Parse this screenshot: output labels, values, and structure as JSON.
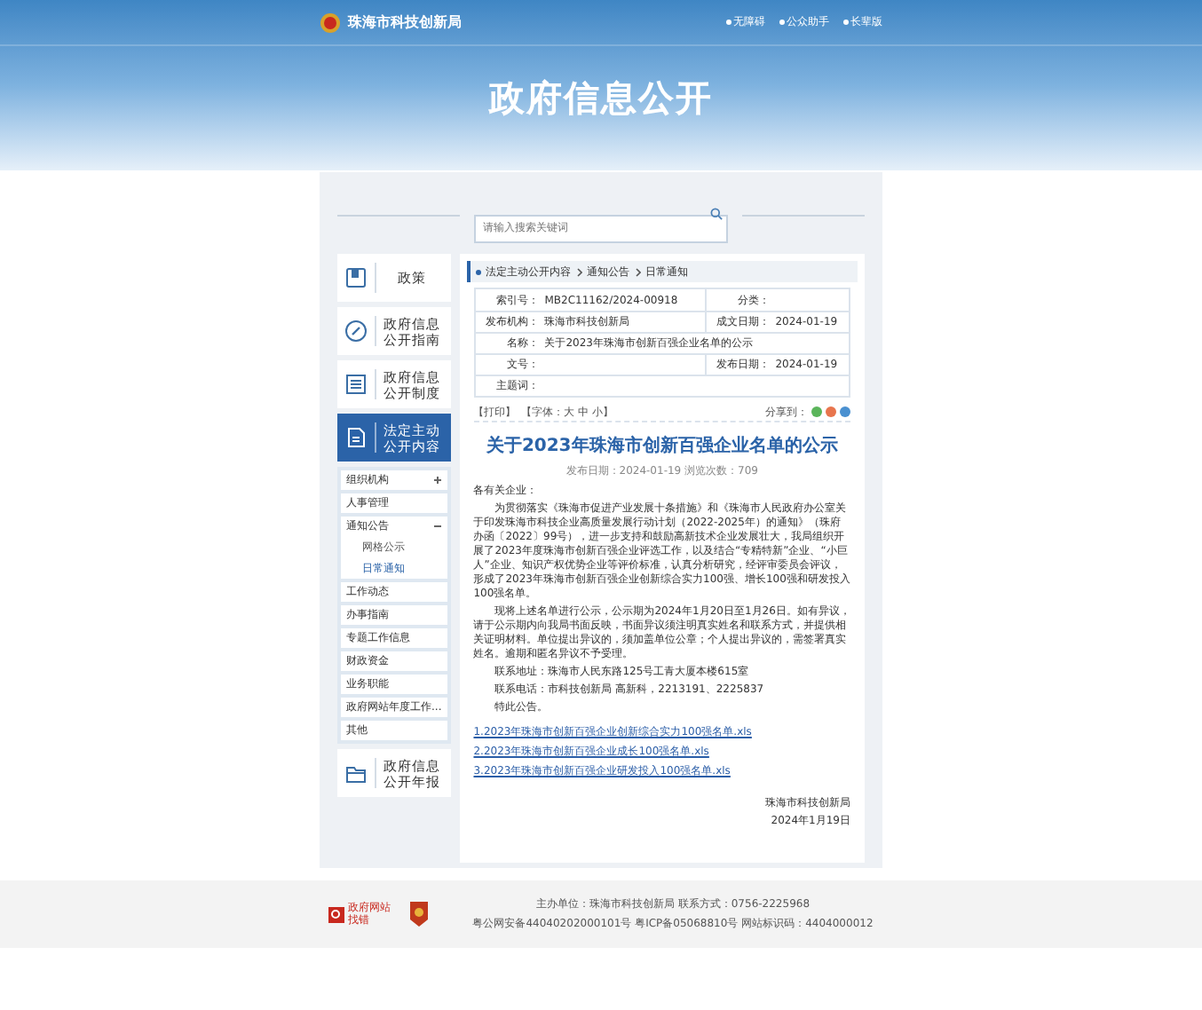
{
  "header": {
    "site_name": "珠海市科技创新局",
    "links": [
      "无障碍",
      "公众助手",
      "长辈版"
    ],
    "title": "政府信息公开"
  },
  "search": {
    "placeholder": "请输入搜索关键词"
  },
  "sidebar": {
    "items": [
      {
        "label": "政策",
        "selected": false
      },
      {
        "label": "政府信息公开指南",
        "selected": false
      },
      {
        "label": "政府信息公开制度",
        "selected": false
      },
      {
        "label": "法定主动公开内容",
        "selected": true
      }
    ],
    "sub_items": [
      {
        "label": "组织机构",
        "expanded": false
      },
      {
        "label": "人事管理"
      },
      {
        "label": "通知公告",
        "expanded": true,
        "children": [
          {
            "label": "网格公示",
            "selected": false
          },
          {
            "label": "日常通知",
            "selected": true
          }
        ]
      },
      {
        "label": "工作动态"
      },
      {
        "label": "办事指南"
      },
      {
        "label": "专题工作信息"
      },
      {
        "label": "财政资金"
      },
      {
        "label": "业务职能"
      },
      {
        "label": "政府网站年度工作..."
      },
      {
        "label": "其他"
      }
    ],
    "bottom_item": {
      "label": "政府信息公开年报",
      "selected": false
    }
  },
  "breadcrumb": [
    "法定主动公开内容",
    "通知公告",
    "日常通知"
  ],
  "meta": [
    [
      {
        "label": "索引号：",
        "value": "MB2C11162/2024-00918"
      },
      {
        "label": "分类："
      }
    ],
    [
      {
        "label": "发布机构：",
        "value": "珠海市科技创新局"
      },
      {
        "label": "成文日期：",
        "value": "2024-01-19"
      }
    ],
    [
      {
        "label": "名称：",
        "value": "关于2023年珠海市创新百强企业名单的公示"
      }
    ],
    [
      {
        "label": "文号："
      },
      {
        "label": "发布日期：",
        "value": "2024-01-19"
      }
    ],
    [
      {
        "label": "主题词："
      }
    ]
  ],
  "tools": {
    "print": "【打印】",
    "font_size": "【字体：大 中 小】",
    "share": "分享到："
  },
  "article": {
    "title": "关于2023年珠海市创新百强企业名单的公示",
    "info": "发布日期：2024-01-19  浏览次数：709",
    "greeting": "各有关企业：",
    "paragraphs": [
      "为贯彻落实《珠海市促进产业发展十条措施》和《珠海市人民政府办公室关于印发珠海市科技企业高质量发展行动计划（2022-2025年）的通知》（珠府办函〔2022〕99号），进一步支持和鼓励高新技术企业发展壮大，我局组织开展了2023年度珠海市创新百强企业评选工作，以及结合“专精特新”企业、“小巨人”企业、知识产权优势企业等评价标准，认真分析研究，经评审委员会评议，形成了2023年珠海市创新百强企业创新综合实力100强、增长100强和研发投入100强名单。",
      "现将上述名单进行公示，公示期为2024年1月20日至1月26日。如有异议，请于公示期内向我局书面反映，书面异议须注明真实姓名和联系方式，并提供相关证明材料。单位提出异议的，须加盖单位公章；个人提出异议的，需签署真实姓名。逾期和匿名异议不予受理。",
      "联系地址：珠海市人民东路125号工青大厦本楼615室",
      "联系电话：市科技创新局 高新科，2213191、2225837",
      "特此公告。"
    ],
    "attachments": [
      "1.2023年珠海市创新百强企业创新综合实力100强名单.xls",
      "2.2023年珠海市创新百强企业成长100强名单.xls",
      "3.2023年珠海市创新百强企业研发投入100强名单.xls"
    ],
    "signature": "珠海市科技创新局",
    "date": "2024年1月19日"
  },
  "footer": {
    "badge": "政府网站找错",
    "lines": [
      "主办单位：珠海市科技创新局  联系方式：0756-2225968",
      "粤公网安备44040202000101号 粤ICP备05068810号 网站标识码：4404000012"
    ]
  }
}
